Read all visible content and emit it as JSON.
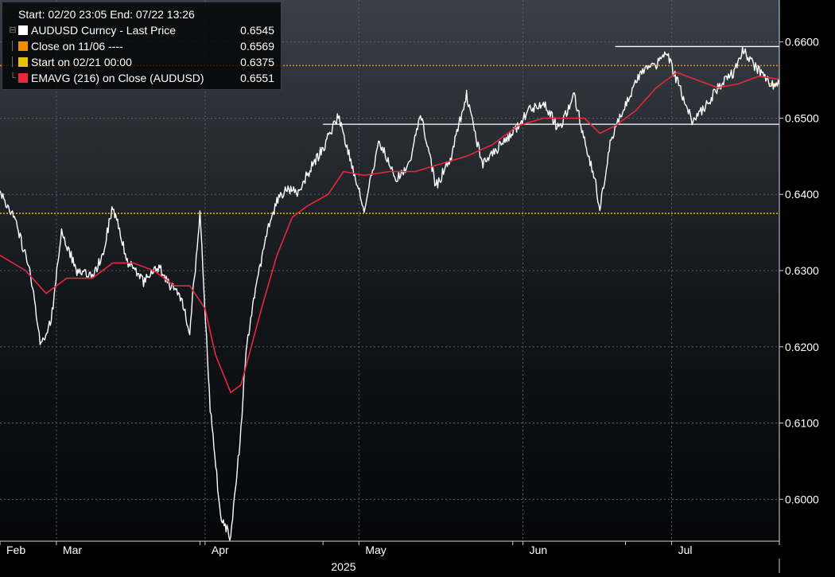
{
  "legend": {
    "range_label": "Start: 02/20 23:05 End: 07/22 13:26",
    "items": [
      {
        "label": "AUDUSD Curncy - Last Price",
        "value": "0.6545",
        "color": "#ffffff"
      },
      {
        "label": "Close on 11/06 ----",
        "value": "0.6569",
        "color": "#f08c00"
      },
      {
        "label": "Start on 02/21 00:00",
        "value": "0.6375",
        "color": "#e8c400"
      },
      {
        "label": "EMAVG (216)  on Close (AUDUSD)",
        "value": "0.6551",
        "color": "#e8283c"
      }
    ]
  },
  "chart_data": {
    "type": "line",
    "x_unit": "date (2025)",
    "xlim": [
      "2025-02-20",
      "2025-07-22"
    ],
    "ylim": [
      0.5945,
      0.6655
    ],
    "y_ticks": [
      "0.6000",
      "0.6100",
      "0.6200",
      "0.6300",
      "0.6400",
      "0.6500",
      "0.6600"
    ],
    "x_ticks": [
      {
        "label": "Feb",
        "date": "2025-02-20"
      },
      {
        "label": "Mar",
        "date": "2025-03-03"
      },
      {
        "label": "Apr",
        "date": "2025-04-01"
      },
      {
        "label": "May",
        "date": "2025-05-01"
      },
      {
        "label": "Jun",
        "date": "2025-06-02"
      },
      {
        "label": "Jul",
        "date": "2025-07-01"
      }
    ],
    "year_label": "2025",
    "grid": true,
    "legend_position": "top-left",
    "reference_lines": [
      {
        "name": "Close on 11/06",
        "value": 0.6569,
        "color": "#f08c00",
        "style": "dotted"
      },
      {
        "name": "Start on 02/21 00:00",
        "value": 0.6375,
        "color": "#e8c400",
        "style": "dotted"
      }
    ],
    "annotation_lines": [
      {
        "y": 0.6594,
        "from": "2025-06-20",
        "to": "2025-07-22",
        "color": "#ffffff"
      },
      {
        "y": 0.6492,
        "from": "2025-04-24",
        "to": "2025-07-22",
        "color": "#ffffff"
      },
      {
        "y": 0.6545,
        "from": "2025-07-20",
        "to": "2025-07-22",
        "color": "#e8c400"
      }
    ],
    "series": [
      {
        "name": "AUDUSD Curncy - Last Price",
        "color": "#ffffff",
        "x": [
          "2025-02-20",
          "2025-02-23",
          "2025-02-26",
          "2025-02-28",
          "2025-03-02",
          "2025-03-04",
          "2025-03-07",
          "2025-03-10",
          "2025-03-12",
          "2025-03-14",
          "2025-03-17",
          "2025-03-20",
          "2025-03-23",
          "2025-03-25",
          "2025-03-27",
          "2025-03-29",
          "2025-03-31",
          "2025-04-02",
          "2025-04-04",
          "2025-04-06",
          "2025-04-08",
          "2025-04-09",
          "2025-04-11",
          "2025-04-13",
          "2025-04-15",
          "2025-04-17",
          "2025-04-19",
          "2025-04-22",
          "2025-04-24",
          "2025-04-27",
          "2025-04-30",
          "2025-05-02",
          "2025-05-05",
          "2025-05-08",
          "2025-05-11",
          "2025-05-13",
          "2025-05-16",
          "2025-05-19",
          "2025-05-22",
          "2025-05-25",
          "2025-05-28",
          "2025-05-31",
          "2025-06-03",
          "2025-06-06",
          "2025-06-09",
          "2025-06-12",
          "2025-06-14",
          "2025-06-16",
          "2025-06-17",
          "2025-06-19",
          "2025-06-22",
          "2025-06-25",
          "2025-06-28",
          "2025-06-30",
          "2025-07-02",
          "2025-07-05",
          "2025-07-08",
          "2025-07-10",
          "2025-07-13",
          "2025-07-15",
          "2025-07-17",
          "2025-07-19",
          "2025-07-21",
          "2025-07-22"
        ],
        "values": [
          0.6405,
          0.6365,
          0.6295,
          0.62,
          0.6235,
          0.635,
          0.63,
          0.629,
          0.632,
          0.6385,
          0.631,
          0.6285,
          0.6305,
          0.628,
          0.627,
          0.622,
          0.6375,
          0.612,
          0.598,
          0.595,
          0.609,
          0.62,
          0.628,
          0.635,
          0.639,
          0.641,
          0.64,
          0.644,
          0.646,
          0.6505,
          0.643,
          0.638,
          0.647,
          0.642,
          0.644,
          0.651,
          0.641,
          0.645,
          0.653,
          0.644,
          0.646,
          0.648,
          0.651,
          0.652,
          0.6485,
          0.653,
          0.647,
          0.642,
          0.638,
          0.647,
          0.652,
          0.656,
          0.657,
          0.6585,
          0.655,
          0.6495,
          0.652,
          0.654,
          0.656,
          0.659,
          0.657,
          0.6555,
          0.654,
          0.6545
        ]
      },
      {
        "name": "EMAVG (216)  on Close (AUDUSD)",
        "color": "#e8283c",
        "x": [
          "2025-02-20",
          "2025-02-25",
          "2025-03-01",
          "2025-03-05",
          "2025-03-10",
          "2025-03-14",
          "2025-03-18",
          "2025-03-22",
          "2025-03-26",
          "2025-03-29",
          "2025-04-01",
          "2025-04-03",
          "2025-04-06",
          "2025-04-08",
          "2025-04-10",
          "2025-04-12",
          "2025-04-15",
          "2025-04-18",
          "2025-04-21",
          "2025-04-25",
          "2025-04-28",
          "2025-05-02",
          "2025-05-07",
          "2025-05-12",
          "2025-05-17",
          "2025-05-22",
          "2025-05-27",
          "2025-06-01",
          "2025-06-06",
          "2025-06-11",
          "2025-06-14",
          "2025-06-17",
          "2025-06-20",
          "2025-06-24",
          "2025-06-28",
          "2025-07-02",
          "2025-07-06",
          "2025-07-10",
          "2025-07-14",
          "2025-07-18",
          "2025-07-22"
        ],
        "values": [
          0.632,
          0.63,
          0.627,
          0.629,
          0.629,
          0.631,
          0.631,
          0.63,
          0.628,
          0.628,
          0.625,
          0.619,
          0.614,
          0.615,
          0.62,
          0.625,
          0.632,
          0.637,
          0.6385,
          0.64,
          0.643,
          0.6425,
          0.643,
          0.643,
          0.644,
          0.645,
          0.6465,
          0.649,
          0.65,
          0.65,
          0.65,
          0.648,
          0.649,
          0.651,
          0.654,
          0.656,
          0.655,
          0.654,
          0.6545,
          0.6555,
          0.6551
        ]
      }
    ]
  }
}
